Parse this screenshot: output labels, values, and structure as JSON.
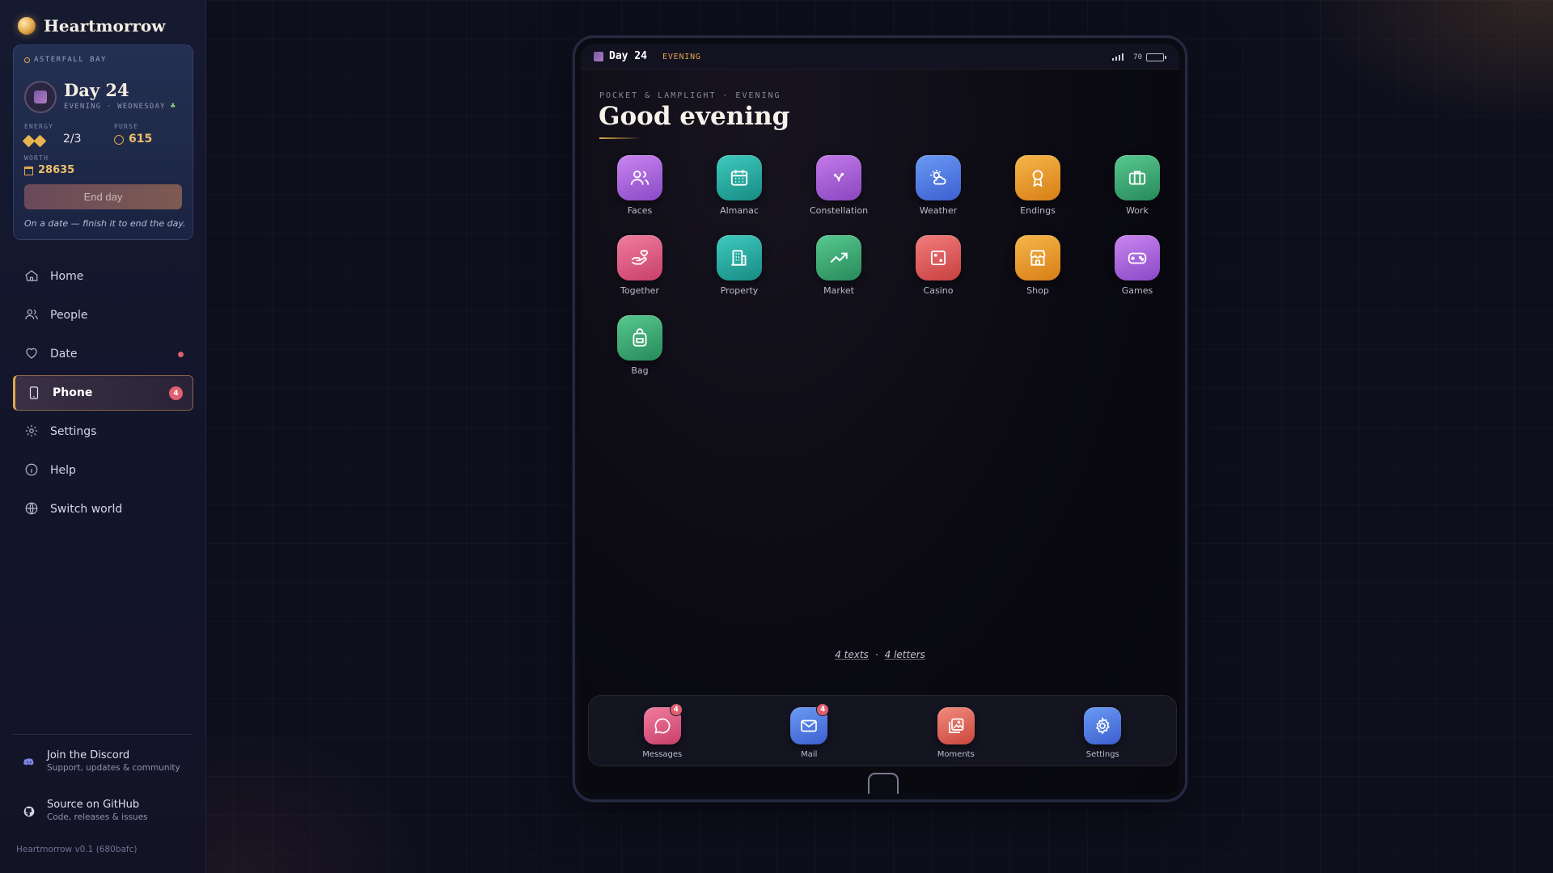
{
  "brand": {
    "name": "Heartmorrow"
  },
  "status_card": {
    "world": "ASTERFALL BAY",
    "day": "Day 24",
    "period": "EVENING · WEDNESDAY",
    "energy_label": "ENERGY",
    "energy_value": "2/3",
    "purse_label": "PURSE",
    "purse_value": "615",
    "worth_label": "WORTH",
    "worth_value": "28635",
    "end_day_label": "End day",
    "note": "On a date — finish it to end the day."
  },
  "nav": {
    "home": "Home",
    "people": "People",
    "date": "Date",
    "phone": "Phone",
    "phone_badge": "4",
    "settings": "Settings",
    "help": "Help",
    "switch_world": "Switch world"
  },
  "links": {
    "discord_title": "Join the Discord",
    "discord_sub": "Support, updates & community",
    "github_title": "Source on GitHub",
    "github_sub": "Code, releases & issues"
  },
  "version": "Heartmorrow v0.1 (680bafc)",
  "phone": {
    "status_day": "Day 24",
    "status_period": "EVENING",
    "battery": "70",
    "eyebrow": "POCKET & LAMPLIGHT · EVENING",
    "greeting": "Good evening",
    "apps": [
      "Faces",
      "Almanac",
      "Constellation",
      "Weather",
      "Endings",
      "Work",
      "Together",
      "Property",
      "Market",
      "Casino",
      "Shop",
      "Games",
      "Bag"
    ],
    "summary_texts": "4 texts",
    "summary_sep": "·",
    "summary_letters": "4 letters",
    "dock": {
      "messages": "Messages",
      "messages_badge": "4",
      "mail": "Mail",
      "mail_badge": "4",
      "moments": "Moments",
      "settings": "Settings"
    }
  },
  "colors": {
    "accent": "#e0a84f",
    "badge": "#e06070",
    "background": "#0e0f1d"
  }
}
